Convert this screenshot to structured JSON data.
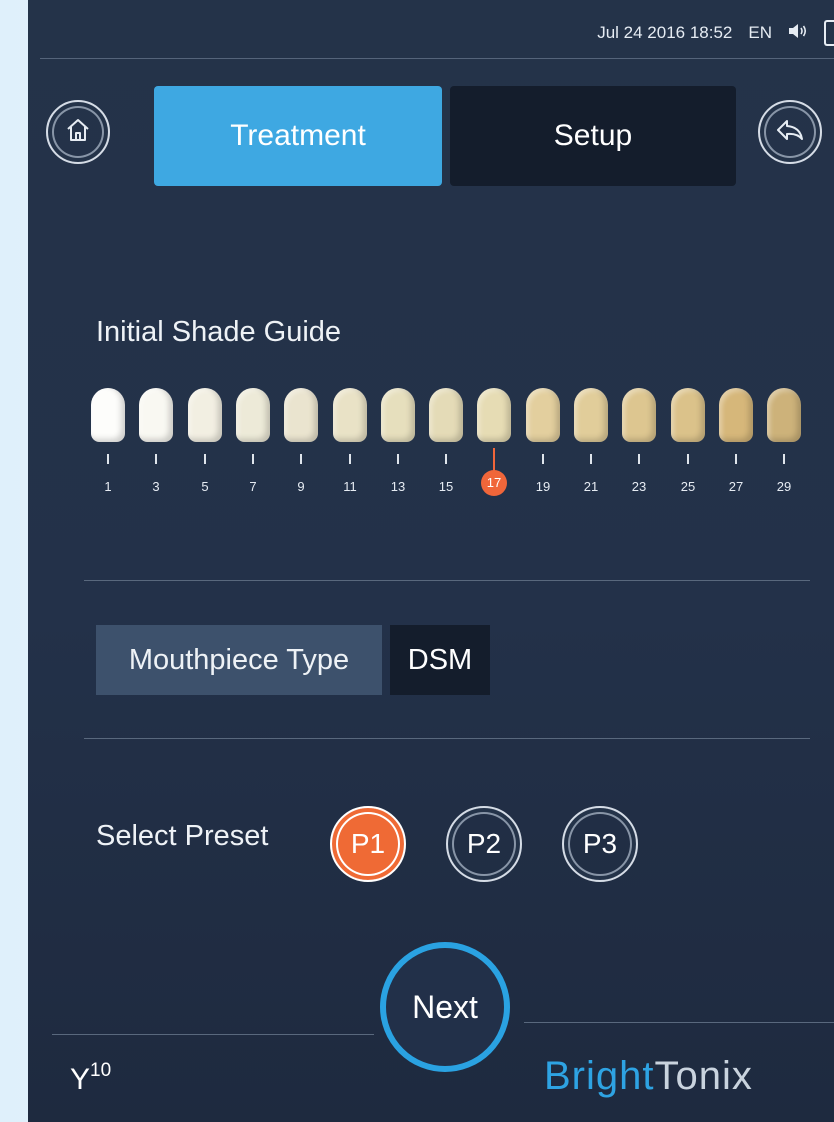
{
  "status": {
    "datetime": "Jul 24 2016  18:52",
    "language": "EN",
    "volume_icon": "speaker-icon",
    "battery_icon": "battery-icon"
  },
  "nav": {
    "home_icon": "home-icon",
    "back_icon": "back-arrow-icon"
  },
  "tabs": [
    {
      "label": "Treatment",
      "active": true
    },
    {
      "label": "Setup",
      "active": false
    }
  ],
  "shade_guide": {
    "title": "Initial Shade Guide",
    "selected": "17",
    "numbers": [
      "1",
      "3",
      "5",
      "7",
      "9",
      "11",
      "13",
      "15",
      "17",
      "19",
      "21",
      "23",
      "25",
      "27",
      "29"
    ],
    "tooth_colors": [
      "#fdfdfb",
      "#f9f8f2",
      "#f2efe2",
      "#edead8",
      "#eae4cf",
      "#e9e2c6",
      "#e6dfbd",
      "#e4dbb7",
      "#e6dcb4",
      "#e3cf9e",
      "#e1cd9a",
      "#ddc690",
      "#dbc28a",
      "#d6b77a",
      "#cdb27a"
    ]
  },
  "mouthpiece": {
    "label": "Mouthpiece Type",
    "value": "DSM"
  },
  "preset": {
    "label": "Select Preset",
    "options": [
      "P1",
      "P2",
      "P3"
    ],
    "selected": "P1"
  },
  "next_label": "Next",
  "branding": {
    "model": "Y",
    "model_sup": "10",
    "brand_part1": "Bright",
    "brand_part2": "Tonix"
  },
  "colors": {
    "accent_blue": "#3ea8e2",
    "accent_orange": "#ef6a35",
    "panel_dark": "#141d2c",
    "panel_mid": "#3d516c"
  }
}
